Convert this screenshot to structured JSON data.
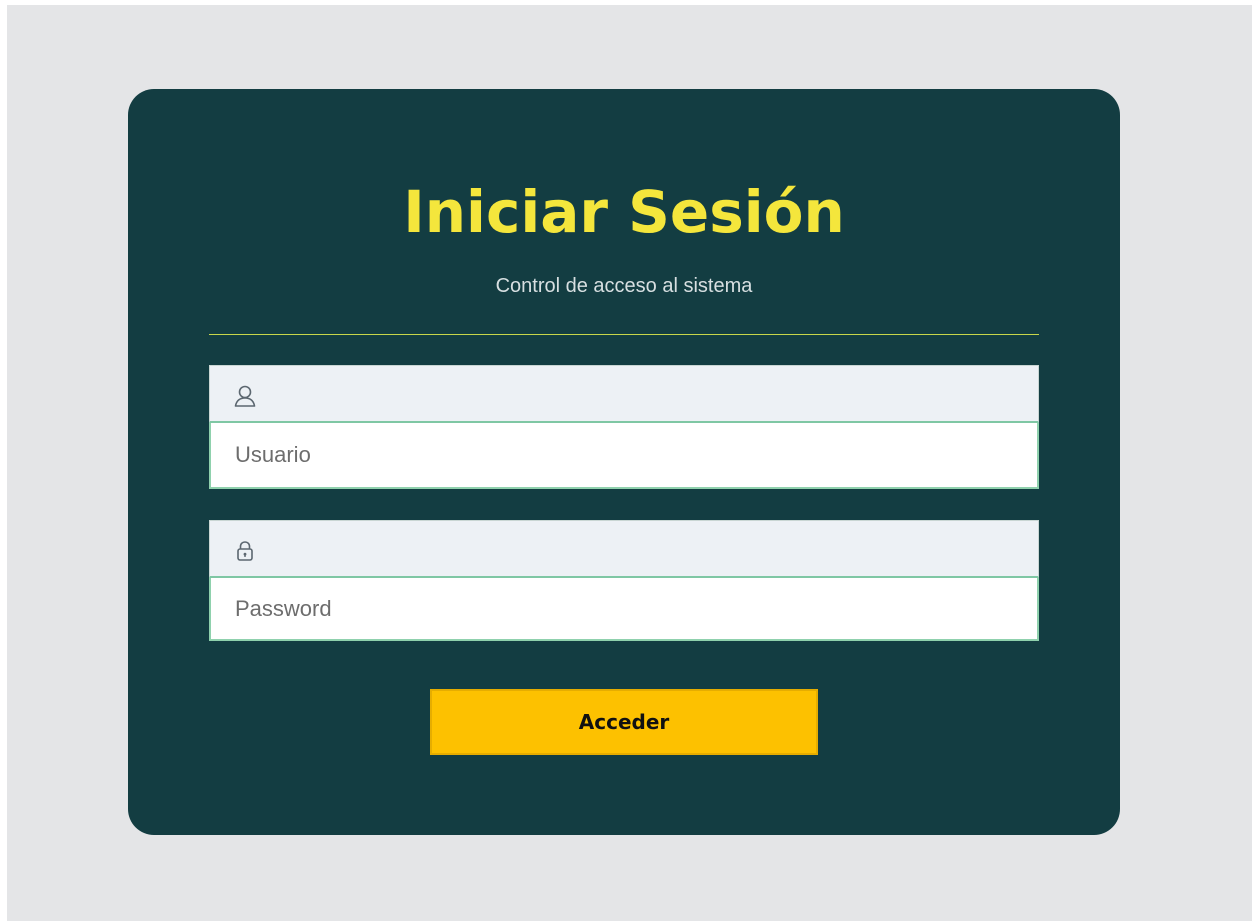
{
  "login": {
    "title": "Iniciar Sesión",
    "subtitle": "Control de acceso al sistema",
    "username": {
      "icon": "user-icon",
      "value": "",
      "placeholder": "Usuario"
    },
    "password": {
      "icon": "lock-icon",
      "value": "",
      "placeholder": "Password"
    },
    "submit_label": "Acceder"
  },
  "colors": {
    "page_background": "#e4e5e7",
    "card_background": "#133d42",
    "title": "#f4e63c",
    "divider": "#c8d64a",
    "input_border": "#8fd1ad",
    "button": "#fdc100"
  }
}
